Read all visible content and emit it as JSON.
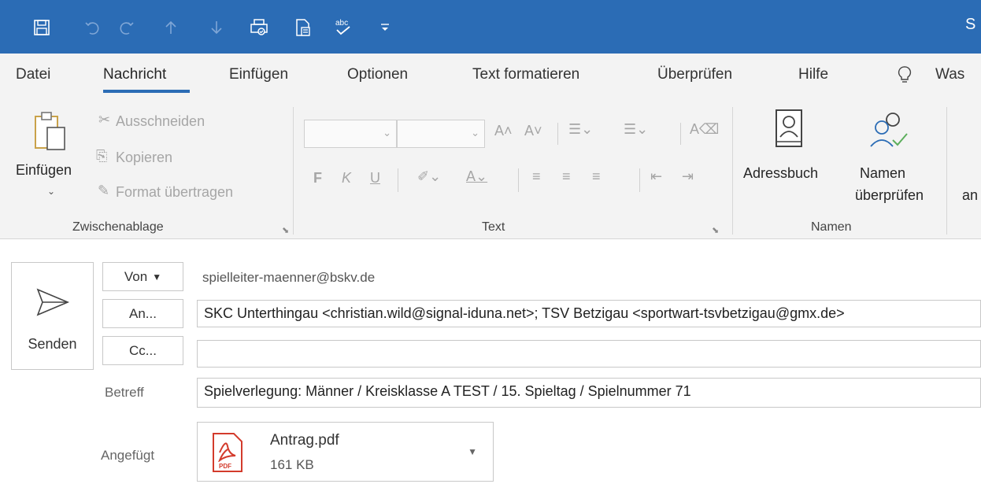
{
  "colors": {
    "title_bar": "#2b6cb5",
    "ribbon_bg": "#f3f3f3",
    "accent": "#2b6cb5",
    "pdf_red": "#d33b2c"
  },
  "titlebar": {
    "title_fragment": "S",
    "quick_access": [
      "save-icon",
      "undo-icon",
      "redo-icon",
      "up-arrow-icon",
      "down-arrow-icon",
      "print-preview-icon",
      "attach-document-icon",
      "spelling-icon",
      "customize-qat-icon"
    ]
  },
  "tabs": [
    "Datei",
    "Nachricht",
    "Einfügen",
    "Optionen",
    "Text formatieren",
    "Überprüfen",
    "Hilfe",
    "Was"
  ],
  "active_tab": "Nachricht",
  "ribbon": {
    "clipboard": {
      "paste": "Einfügen",
      "cut": "Ausschneiden",
      "copy": "Kopieren",
      "format_painter": "Format übertragen",
      "group": "Zwischenablage"
    },
    "text": {
      "bold": "F",
      "italic": "K",
      "underline": "U",
      "group": "Text"
    },
    "names": {
      "address_book": "Adressbuch",
      "check_names_line1": "Namen",
      "check_names_line2": "überprüfen",
      "group": "Namen"
    },
    "cutoff": "an"
  },
  "compose": {
    "send": "Senden",
    "from_button": "Von",
    "from_value": "spielleiter-maenner@bskv.de",
    "to_button": "An...",
    "to_value": "SKC Unterthingau <christian.wild@signal-iduna.net>; TSV Betzigau <sportwart-tsvbetzigau@gmx.de>",
    "cc_button": "Cc...",
    "cc_value": "",
    "subject_label": "Betreff",
    "subject_value": "Spielverlegung: Männer / Kreisklasse A TEST / 15. Spieltag / Spielnummer 71",
    "attached_label": "Angefügt",
    "attachment": {
      "name": "Antrag.pdf",
      "size": "161 KB",
      "icon_text": "PDF"
    }
  }
}
